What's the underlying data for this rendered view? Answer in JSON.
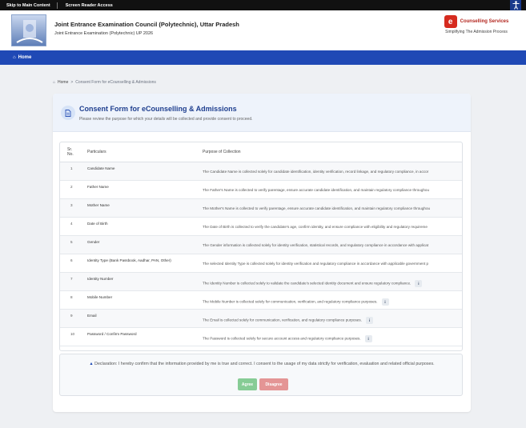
{
  "topbar": {
    "skip_link": "Skip to Main Content",
    "reader_link": "Screen Reader Access",
    "accessibility_icon": "accessibility-person-icon"
  },
  "header": {
    "title": "Joint Entrance Examination Council (Polytechnic), Uttar Pradesh",
    "subtitle": "Joint Entrance Examination (Polytechnic) UP 2026",
    "logo_letter": "e",
    "logo_name": "Counselling Services",
    "logo_tagline": "Simplifying The Admission Process"
  },
  "nav": {
    "home_label": "Home"
  },
  "breadcrumb": {
    "home": "Home",
    "separator": ">",
    "current": "Consent Form for eCounselling & Admissions"
  },
  "card": {
    "title": "Consent Form for eCounselling & Admissions",
    "subtitle": "Please review the purpose for which your details will be collected and provide consent to proceed."
  },
  "table": {
    "headers": {
      "sr_line1": "Sr.",
      "sr_line2": "No.",
      "particulars": "Particulars",
      "purpose": "Purpose of Collection"
    },
    "rows": [
      {
        "sr": "1",
        "particular": "Candidate Name",
        "purpose": "The Candidate Name is collected solely for candidate identification, identity verification, record linkage, and regulatory compliance, in accor",
        "info": false
      },
      {
        "sr": "2",
        "particular": "Father Name",
        "purpose": "The Father's Name is collected to verify parentage, ensure accurate candidate identification, and maintain regulatory compliance throughou",
        "info": false
      },
      {
        "sr": "3",
        "particular": "Mother Name",
        "purpose": "The Mother's Name is collected to verify parentage, ensure accurate candidate identification, and maintain regulatory compliance throughou",
        "info": false
      },
      {
        "sr": "4",
        "particular": "Date of Birth",
        "purpose": "The Date of Birth is collected to verify the candidate's age, confirm identity, and ensure compliance with eligibility and regulatory requireme",
        "info": false
      },
      {
        "sr": "5",
        "particular": "Gender",
        "purpose": "The Gender information is collected solely for identity verification, statistical records, and regulatory compliance in accordance with applicat",
        "info": false
      },
      {
        "sr": "6",
        "particular": "Identity Type (Bank Passbook, Aadhar, PAN, Other)",
        "purpose": "The selected Identity Type is collected solely for identity verification and regulatory compliance in accordance with applicable government p",
        "info": false
      },
      {
        "sr": "7",
        "particular": "Identity Number",
        "purpose": "The Identity Number is collected solely to validate the candidate's selected identity document and ensure regulatory compliance.",
        "info": true
      },
      {
        "sr": "8",
        "particular": "Mobile Number",
        "purpose": "The Mobile Number is collected solely for communication, verification, and regulatory compliance purposes.",
        "info": true
      },
      {
        "sr": "9",
        "particular": "Email",
        "purpose": "The Email is collected solely for communication, verification, and regulatory compliance purposes.",
        "info": true
      },
      {
        "sr": "10",
        "particular": "Password / Confirm Password",
        "purpose": "The Password is collected solely for secure account access and regulatory compliance purposes.",
        "info": true
      }
    ]
  },
  "declaration": {
    "icon": "warning-icon",
    "text": "Declaration: I hereby confirm that the information provided by me is true and correct. I consent to the usage of my data strictly for verification, evaluation and related official purposes.",
    "agree_label": "Agree",
    "disagree_label": "Disagree"
  },
  "colors": {
    "nav": "#1f49b5",
    "title": "#1f3f8f",
    "agree": "#86cc95",
    "disagree": "#e49595",
    "logo": "#d62b1f"
  }
}
